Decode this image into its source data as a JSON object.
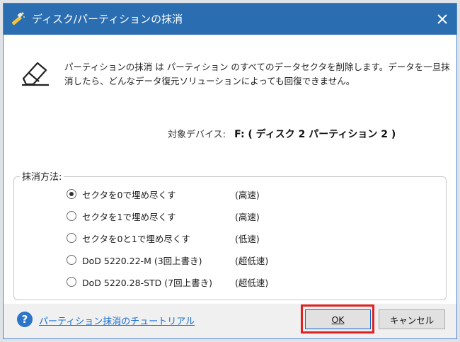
{
  "dialog": {
    "title": "ディスク/パーティションの抹消",
    "description": "パーティションの抹消 は パーティション のすべてのデータセクタを削除します。データを一旦抹消したら、どんなデータ復元ソリューションによっても回復できません。",
    "target_label": "対象デバイス:",
    "target_value": "F: ( ディスク 2 パーティション 2 )",
    "method_group_label": "抹消方法:",
    "methods": [
      {
        "label": "セクタを0で埋め尽くす",
        "speed": "(高速)",
        "checked": true
      },
      {
        "label": "セクタを1で埋め尽くす",
        "speed": "(高速)",
        "checked": false
      },
      {
        "label": "セクタを0と1で埋め尽くす",
        "speed": "(低速)",
        "checked": false
      },
      {
        "label": "DoD 5220.22-M (3回上書き)",
        "speed": "(超低速)",
        "checked": false
      },
      {
        "label": "DoD 5220.28-STD (7回上書き)",
        "speed": "(超低速)",
        "checked": false
      }
    ],
    "help_link": "パーティション抹消のチュートリアル",
    "ok_label": "OK",
    "cancel_label": "キャンセル"
  },
  "colors": {
    "titlebar": "#2a6db1",
    "link": "#1a6fd1",
    "highlight": "#e32020"
  },
  "icons": {
    "app": "wand-icon",
    "close": "close-icon",
    "eraser": "eraser-icon",
    "help": "help-icon"
  }
}
